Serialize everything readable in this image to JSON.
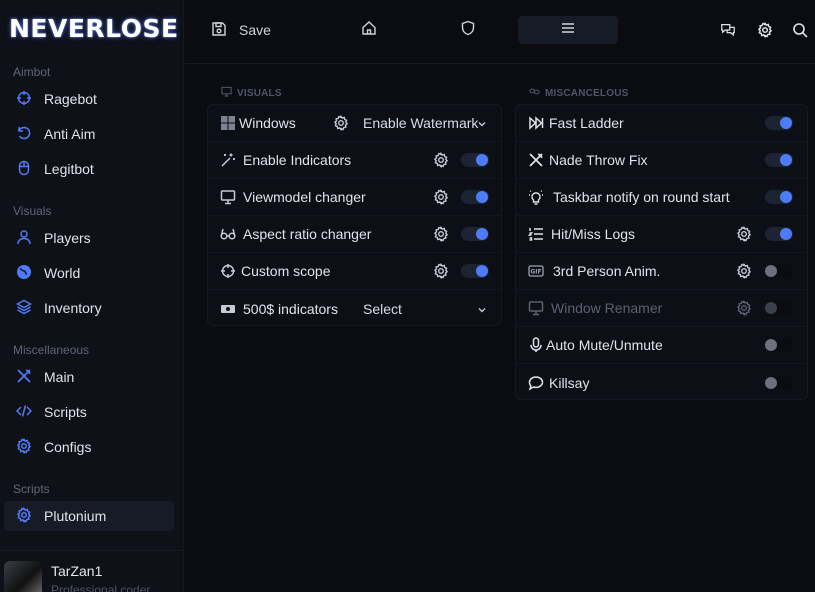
{
  "app": {
    "logo": "NEVERLOSE"
  },
  "sidebar": {
    "sections": [
      {
        "label": "Aimbot",
        "items": [
          {
            "label": "Ragebot"
          },
          {
            "label": "Anti Aim"
          },
          {
            "label": "Legitbot"
          }
        ]
      },
      {
        "label": "Visuals",
        "items": [
          {
            "label": "Players"
          },
          {
            "label": "World"
          },
          {
            "label": "Inventory"
          }
        ]
      },
      {
        "label": "Miscellaneous",
        "items": [
          {
            "label": "Main"
          },
          {
            "label": "Scripts"
          },
          {
            "label": "Configs"
          }
        ]
      },
      {
        "label": "Scripts",
        "items": [
          {
            "label": "Plutonium",
            "active": true
          }
        ]
      }
    ],
    "user": {
      "name": "TarZan1",
      "role": "Professional coder"
    }
  },
  "topbar": {
    "save_label": "Save",
    "tabs": [
      {
        "icon": "home-icon"
      },
      {
        "icon": "shield-icon"
      },
      {
        "icon": "menu-icon",
        "active": true
      }
    ],
    "right_icons": [
      "chat-icon",
      "settings-icon",
      "search-icon"
    ]
  },
  "visuals": {
    "title": "VISUALS",
    "rows": [
      {
        "label": "Windows",
        "icon": "windows-icon",
        "gear": true,
        "select": "Enable Watermark"
      },
      {
        "label": "Enable Indicators",
        "icon": "wand-icon",
        "gear": true,
        "toggle": true
      },
      {
        "label": "Viewmodel changer",
        "icon": "monitor-icon",
        "gear": true,
        "toggle": true
      },
      {
        "label": "Aspect ratio changer",
        "icon": "glasses-icon",
        "gear": true,
        "toggle": true
      },
      {
        "label": "Custom scope",
        "icon": "crosshair-icon",
        "gear": true,
        "toggle": true
      },
      {
        "label": "500$ indicators",
        "icon": "money-icon",
        "gear": false,
        "select": "Select"
      }
    ]
  },
  "misc": {
    "title": "MISCANCELOUS",
    "rows": [
      {
        "label": "Fast Ladder",
        "icon": "fast-forward-icon",
        "gear": false,
        "toggle": true
      },
      {
        "label": "Nade Throw Fix",
        "icon": "tools-icon",
        "gear": false,
        "toggle": true
      },
      {
        "label": "Taskbar notify on round start",
        "icon": "lightbulb-icon",
        "gear": false,
        "toggle": true
      },
      {
        "label": "Hit/Miss Logs",
        "icon": "list-icon",
        "gear": true,
        "toggle": true
      },
      {
        "label": "3rd Person Anim.",
        "icon": "gif-icon",
        "gear": true,
        "toggle": false
      },
      {
        "label": "Window Renamer",
        "icon": "monitor-icon",
        "gear": true,
        "toggle": false,
        "disabled": true
      },
      {
        "label": "Auto Mute/Unmute",
        "icon": "microphone-icon",
        "gear": false,
        "toggle": false
      },
      {
        "label": "Killsay",
        "icon": "chat-bubble-icon",
        "gear": false,
        "toggle": false
      }
    ]
  },
  "colors": {
    "accent": "#4f7bf7",
    "bg": "#0a0c12",
    "panel": "#0c0f16"
  }
}
